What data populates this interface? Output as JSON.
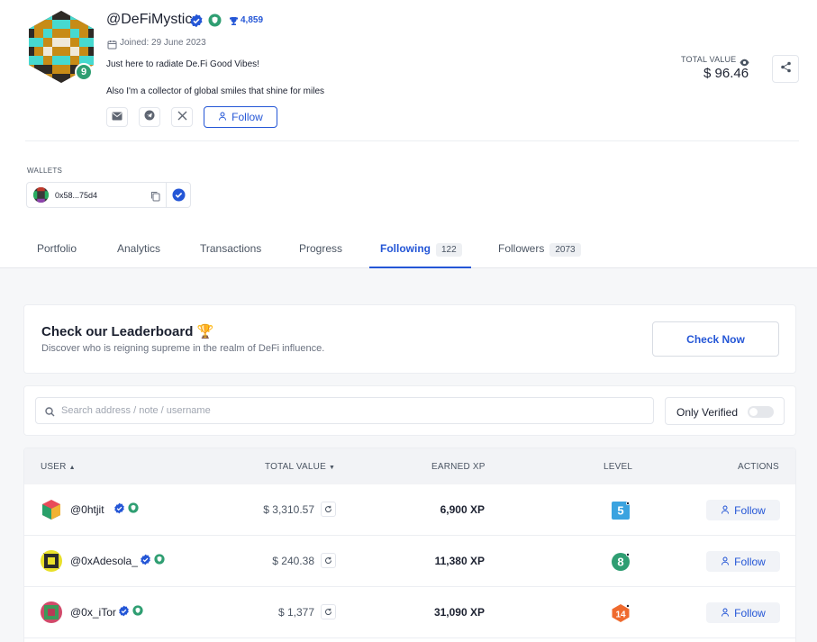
{
  "profile": {
    "username": "@DeFiMystic",
    "level": "9",
    "xp": "4,859",
    "joined": "Joined: 29 June 2023",
    "bio_line1": "Just here to radiate De.Fi Good Vibes!",
    "bio_line2": "Also I'm a collector of global smiles that shine for miles",
    "follow_label": "Follow",
    "social_icons": [
      "mail-icon",
      "telegram-icon",
      "x-icon"
    ]
  },
  "total_value": {
    "label": "TOTAL VALUE",
    "value": "$ 96.46"
  },
  "wallets": {
    "label": "WALLETS",
    "items": [
      {
        "address": "0x58...75d4"
      }
    ]
  },
  "tabs": [
    {
      "label": "Portfolio",
      "count": ""
    },
    {
      "label": "Analytics",
      "count": ""
    },
    {
      "label": "Transactions",
      "count": ""
    },
    {
      "label": "Progress",
      "count": ""
    },
    {
      "label": "Following",
      "count": "122",
      "active": true
    },
    {
      "label": "Followers",
      "count": "2073"
    }
  ],
  "leaderboard": {
    "title": "Check our Leaderboard 🏆",
    "subtitle": "Discover who is reigning supreme in the realm of DeFi influence.",
    "button": "Check Now"
  },
  "search": {
    "placeholder": "Search address / note / username",
    "only_verified_label": "Only Verified",
    "only_verified_on": false
  },
  "table": {
    "headers": {
      "user": "USER",
      "total_value": "TOTAL VALUE",
      "earned_xp": "EARNED XP",
      "level": "LEVEL",
      "actions": "ACTIONS"
    },
    "rows": [
      {
        "name": "@0htjit",
        "value": "$ 3,310.57",
        "xp": "6,900 XP",
        "level": "5",
        "level_color": "#3aa3e0",
        "action": "Follow"
      },
      {
        "name": "@0xAdesola_",
        "value": "$ 240.38",
        "xp": "11,380 XP",
        "level": "8",
        "level_color": "#2f9e72",
        "action": "Follow"
      },
      {
        "name": "@0x_iTor",
        "value": "$ 1,377",
        "xp": "31,090 XP",
        "level": "14",
        "level_color": "#ef6a2e",
        "action": "Follow"
      }
    ]
  },
  "colors": {
    "accent": "#2456d6",
    "verified": "#2456d6",
    "badge_green": "#2f9e72"
  }
}
